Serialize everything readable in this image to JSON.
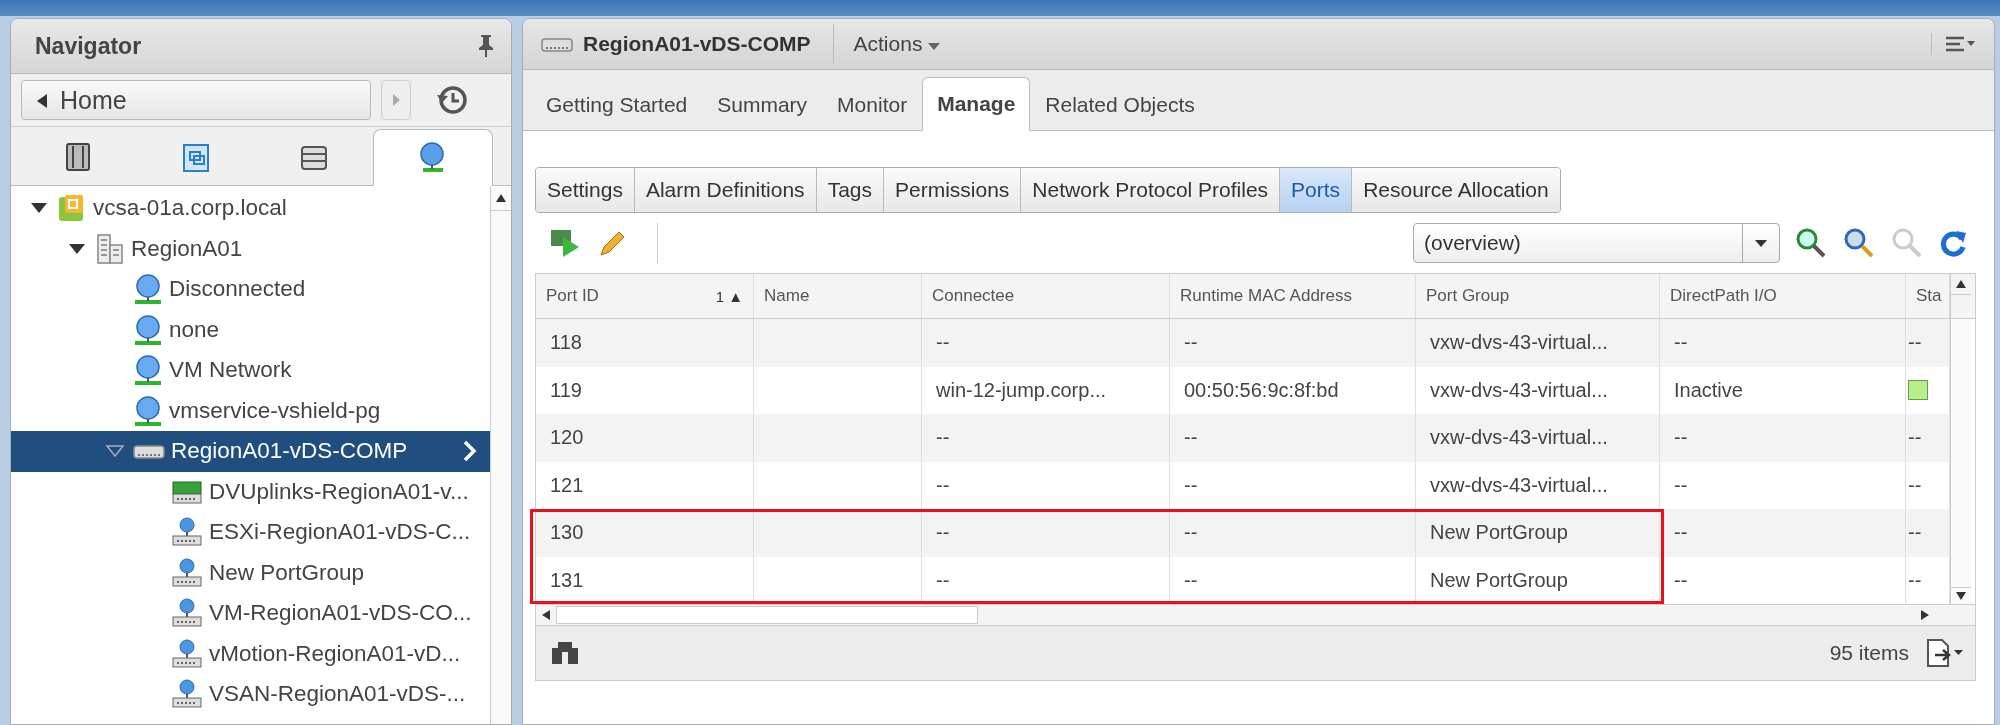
{
  "navigator": {
    "title": "Navigator",
    "home_label": "Home",
    "view_tabs": [
      {
        "kind": "hosts",
        "selected": false
      },
      {
        "kind": "vms",
        "selected": false
      },
      {
        "kind": "storage",
        "selected": false
      },
      {
        "kind": "network",
        "selected": true
      }
    ],
    "tree": [
      {
        "label": "vcsa-01a.corp.local",
        "kind": "vcenter",
        "expanded": true,
        "selected": false,
        "children": [
          {
            "label": "RegionA01",
            "kind": "datacenter",
            "expanded": true,
            "selected": false,
            "children": [
              {
                "label": "Disconnected",
                "kind": "network",
                "selected": false
              },
              {
                "label": "none",
                "kind": "network",
                "selected": false
              },
              {
                "label": "VM Network",
                "kind": "network",
                "selected": false
              },
              {
                "label": "vmservice-vshield-pg",
                "kind": "network",
                "selected": false
              },
              {
                "label": "RegionA01-vDS-COMP",
                "kind": "dvswitch",
                "expanded": true,
                "selected": true,
                "children": [
                  {
                    "label": "DVUplinks-RegionA01-v...",
                    "kind": "uplink",
                    "selected": false
                  },
                  {
                    "label": "ESXi-RegionA01-vDS-C...",
                    "kind": "portgroup",
                    "selected": false
                  },
                  {
                    "label": "New PortGroup",
                    "kind": "portgroup",
                    "selected": false
                  },
                  {
                    "label": "VM-RegionA01-vDS-CO...",
                    "kind": "portgroup",
                    "selected": false
                  },
                  {
                    "label": "vMotion-RegionA01-vD...",
                    "kind": "portgroup",
                    "selected": false
                  },
                  {
                    "label": "VSAN-RegionA01-vDS-...",
                    "kind": "portgroup",
                    "selected": false
                  }
                ]
              }
            ]
          }
        ]
      }
    ]
  },
  "object": {
    "title": "RegionA01-vDS-COMP",
    "actions": "Actions"
  },
  "tabs": [
    {
      "label": "Getting Started",
      "selected": false
    },
    {
      "label": "Summary",
      "selected": false
    },
    {
      "label": "Monitor",
      "selected": false
    },
    {
      "label": "Manage",
      "selected": true
    },
    {
      "label": "Related Objects",
      "selected": false
    }
  ],
  "sub_tabs": [
    {
      "label": "Settings",
      "selected": false
    },
    {
      "label": "Alarm Definitions",
      "selected": false
    },
    {
      "label": "Tags",
      "selected": false
    },
    {
      "label": "Permissions",
      "selected": false
    },
    {
      "label": "Network Protocol Profiles",
      "selected": false
    },
    {
      "label": "Ports",
      "selected": true
    },
    {
      "label": "Resource Allocation",
      "selected": false
    }
  ],
  "view_select": "(overview)",
  "table": {
    "columns": [
      "Port ID",
      "Name",
      "Connectee",
      "Runtime MAC Address",
      "Port Group",
      "DirectPath I/O",
      "Sta"
    ],
    "sort_mark": "1 ▲",
    "rows": [
      {
        "cells": [
          "118",
          "",
          "--",
          "--",
          "vxw-dvs-43-virtual...",
          "--"
        ],
        "column_7": "--",
        "status_light": false,
        "annotated": false
      },
      {
        "cells": [
          "119",
          "",
          "win-12-jump.corp...",
          "00:50:56:9c:8f:bd",
          "vxw-dvs-43-virtual...",
          "Inactive"
        ],
        "status_light": true,
        "annotated": false
      },
      {
        "cells": [
          "120",
          "",
          "--",
          "--",
          "vxw-dvs-43-virtual...",
          "--"
        ],
        "column_7": "--",
        "status_light": false,
        "annotated": false
      },
      {
        "cells": [
          "121",
          "",
          "--",
          "--",
          "vxw-dvs-43-virtual...",
          "--"
        ],
        "column_7": "--",
        "status_light": false,
        "annotated": false
      },
      {
        "cells": [
          "130",
          "",
          "--",
          "--",
          "New PortGroup",
          "--"
        ],
        "column_7": "--",
        "status_light": false,
        "annotated": true
      },
      {
        "cells": [
          "131",
          "",
          "--",
          "--",
          "New PortGroup",
          "--"
        ],
        "column_7": "--",
        "status_light": false,
        "annotated": true
      }
    ],
    "item_count": "95 items"
  }
}
